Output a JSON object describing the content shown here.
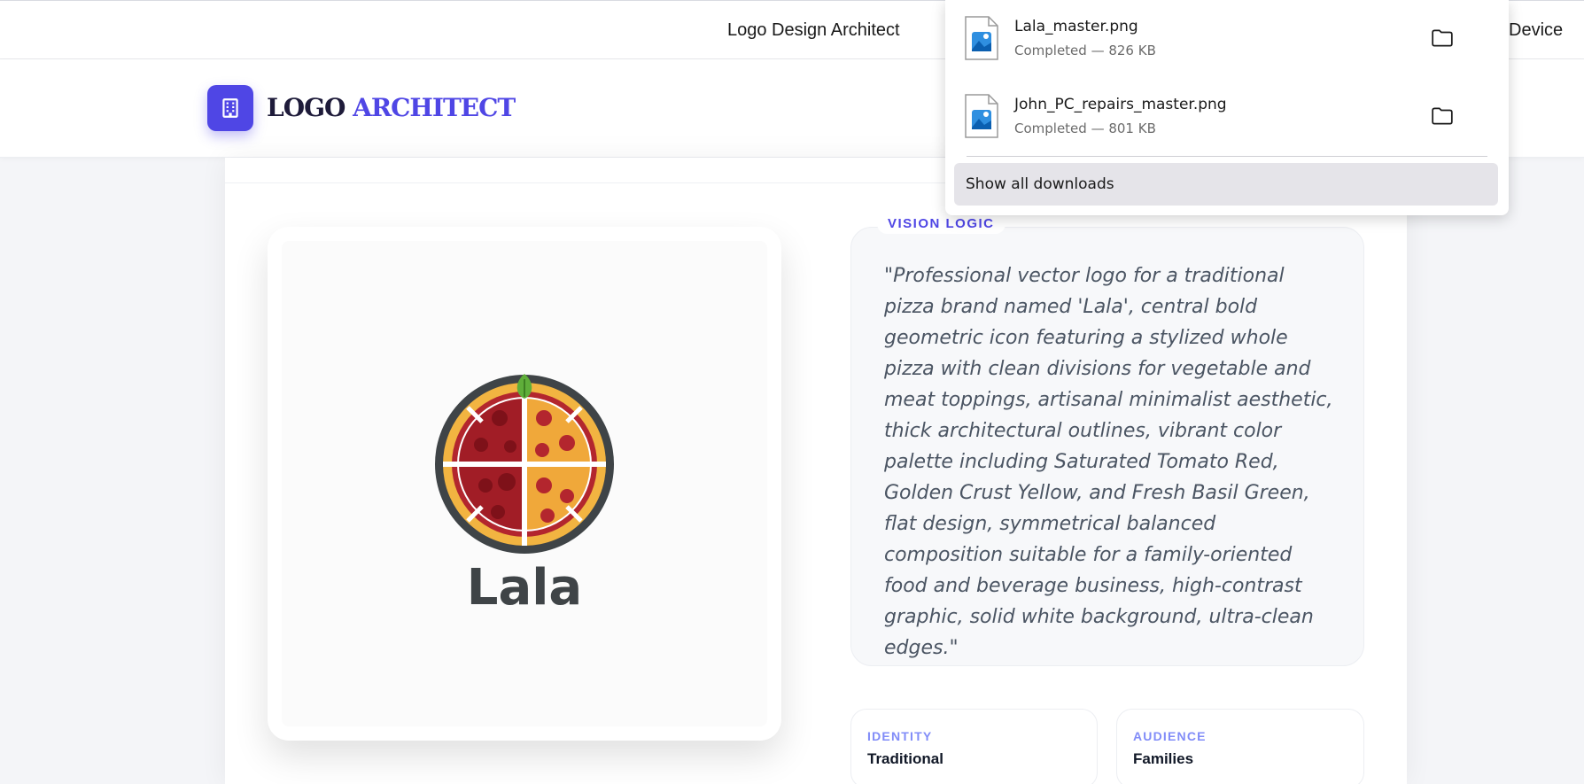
{
  "browser": {
    "tab_title": "Logo Design Architect",
    "device_label": "Device"
  },
  "header": {
    "brand_part1": "LOGO",
    "brand_part2": "ARCHITECT",
    "logo_icon": "building-icon"
  },
  "preview": {
    "logo_wordmark": "Lala"
  },
  "vision": {
    "tag": "VISION LOGIC",
    "prompt": "\"Professional vector logo for a traditional pizza brand named 'Lala', central bold geometric icon featuring a stylized whole pizza with clean divisions for vegetable and meat toppings, artisanal minimalist aesthetic, thick architectural outlines, vibrant color palette including Saturated Tomato Red, Golden Crust Yellow, and Fresh Basil Green, flat design, symmetrical balanced composition suitable for a family-oriented food and beverage business, high-contrast graphic, solid white background, ultra-clean edges.\""
  },
  "attributes": [
    {
      "key": "IDENTITY",
      "value": "Traditional"
    },
    {
      "key": "AUDIENCE",
      "value": "Families"
    }
  ],
  "downloads": {
    "items": [
      {
        "name": "Lala_master.png",
        "status": "Completed — 826 KB",
        "icon": "image-file-icon"
      },
      {
        "name": "John_PC_repairs_master.png",
        "status": "Completed — 801 KB",
        "icon": "image-file-icon"
      }
    ],
    "show_all_label": "Show all downloads"
  },
  "colors": {
    "accent": "#4f46e5",
    "tomato_red": "#b3262e",
    "crust_yellow": "#f2b441",
    "basil_green": "#5fae3a",
    "outline": "#3f4447"
  }
}
